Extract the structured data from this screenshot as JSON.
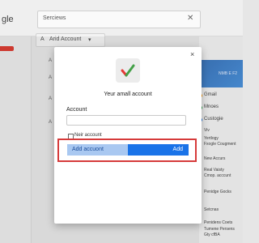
{
  "app": {
    "logo_fragment": "gle"
  },
  "search": {
    "value": "Serciews",
    "close_glyph": "✕"
  },
  "account_button": {
    "label": "Arid Account",
    "prefix_glyph": "A",
    "caret": "▾"
  },
  "background_labels": [
    "A",
    "A",
    "A",
    "A"
  ],
  "right_panel": {
    "banner": "NMB E F2",
    "items": [
      {
        "label": "Gmail",
        "color": "#ff9800"
      },
      {
        "label": "Mnoes",
        "color": "#34a853"
      },
      {
        "label": "Custogie",
        "color": "#1a73e8"
      }
    ],
    "text_lines": [
      "Viv",
      "Yertlogy",
      "Fxogle Cougment",
      "New Accurs",
      "Real Vaisty",
      "Cmop. acccunt",
      "Penidge Gocks",
      "Setcnas",
      "Penidens Coets",
      "Tumene Persens",
      "Gty cfBA"
    ]
  },
  "modal": {
    "close_glyph": "×",
    "title": "Yeur amall account",
    "account_label": "Account",
    "input_value": "",
    "checkbox_label": "Neir account",
    "add_account_label": "Add accuont",
    "add_label": "Add"
  }
}
